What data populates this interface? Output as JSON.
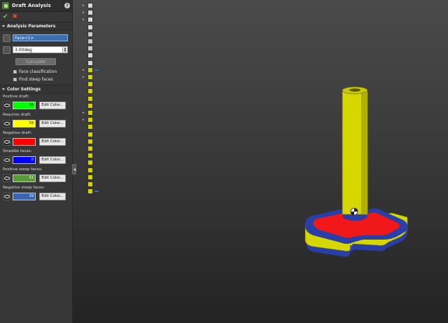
{
  "panel": {
    "title": "Draft Analysis",
    "help_glyph": "?",
    "ok_glyph": "✔",
    "cancel_glyph": "✖",
    "analysis_params": {
      "header": "Analysis Parameters",
      "face_value": "Face<1>",
      "angle_value": "3.00deg",
      "calculate_label": "Calculate",
      "face_classification_label": "Face classification",
      "find_steep_label": "Find steep faces",
      "check_glyph": "✓"
    },
    "color_settings": {
      "header": "Color Settings",
      "edit_label": "Edit Color...",
      "rows": [
        {
          "label": "Positive draft:",
          "count": "35",
          "color": "#00ff00"
        },
        {
          "label": "Requires draft:",
          "count": "59",
          "color": "#ffff00"
        },
        {
          "label": "Negative draft:",
          "count": "",
          "color": "#ff0000"
        },
        {
          "label": "Straddle faces:",
          "count": "0",
          "color": "#0000ff"
        },
        {
          "label": "Positive steep faces:",
          "count": "51",
          "color": "#5a9a3a"
        },
        {
          "label": "Negative steep faces:",
          "count": "29",
          "color": "#3a66b0"
        }
      ]
    }
  },
  "tree": {
    "items": [
      {
        "label": "",
        "icon": "folder-icon",
        "color": "#d8d8d8",
        "arrow": "▸"
      },
      {
        "label": "",
        "icon": "sensor-icon",
        "color": "#d8d8d8",
        "arrow": "▸"
      },
      {
        "label": "",
        "icon": "annotation-icon",
        "color": "#d8d8d8",
        "arrow": "▸"
      },
      {
        "label": "",
        "icon": "material-icon",
        "color": "#d8d8d8",
        "arrow": ""
      },
      {
        "label": "",
        "icon": "plane-icon",
        "color": "#c8c8c8",
        "arrow": ""
      },
      {
        "label": "",
        "icon": "plane-icon",
        "color": "#c8c8c8",
        "arrow": ""
      },
      {
        "label": "",
        "icon": "plane-icon",
        "color": "#c8c8c8",
        "arrow": ""
      },
      {
        "label": "",
        "icon": "origin-icon",
        "color": "#d8d8d8",
        "arrow": ""
      },
      {
        "label": "",
        "icon": "origin-icon",
        "color": "#d8d8d8",
        "arrow": ""
      },
      {
        "label": "",
        "icon": "extrude-icon",
        "color": "#d4d400",
        "arrow": "▸",
        "selected": true
      },
      {
        "label": "",
        "icon": "extrude-icon",
        "color": "#d4d400",
        "arrow": "▸"
      },
      {
        "label": "",
        "icon": "fillet-icon",
        "color": "#d4d400",
        "arrow": ""
      },
      {
        "label": "",
        "icon": "fillet-icon",
        "color": "#d4d400",
        "arrow": ""
      },
      {
        "label": "",
        "icon": "fillet-icon",
        "color": "#d4d400",
        "arrow": ""
      },
      {
        "label": "",
        "icon": "fillet-icon",
        "color": "#d4d400",
        "arrow": ""
      },
      {
        "label": "",
        "icon": "extrude-icon",
        "color": "#d4d400",
        "arrow": "▸"
      },
      {
        "label": "",
        "icon": "extrude-icon",
        "color": "#d4d400",
        "arrow": "▸"
      },
      {
        "label": "",
        "icon": "fillet-icon",
        "color": "#d4d400",
        "arrow": ""
      },
      {
        "label": "",
        "icon": "fillet-icon",
        "color": "#d4d400",
        "arrow": ""
      },
      {
        "label": "",
        "icon": "fillet-icon",
        "color": "#d4d400",
        "arrow": ""
      },
      {
        "label": "",
        "icon": "fillet-icon",
        "color": "#d4d400",
        "arrow": ""
      },
      {
        "label": "",
        "icon": "fillet-icon",
        "color": "#d4d400",
        "arrow": ""
      },
      {
        "label": "",
        "icon": "fillet-icon",
        "color": "#d4d400",
        "arrow": ""
      },
      {
        "label": "",
        "icon": "fillet-icon",
        "color": "#d4d400",
        "arrow": ""
      },
      {
        "label": "",
        "icon": "fillet-icon",
        "color": "#d4d400",
        "arrow": ""
      },
      {
        "label": "",
        "icon": "fillet-icon",
        "color": "#d4d400",
        "arrow": ""
      },
      {
        "label": "",
        "icon": "shell-icon",
        "color": "#d4d400",
        "arrow": "",
        "selected": true
      }
    ]
  },
  "model": {
    "colors": {
      "yellow": "#d6d600",
      "yellow_dark": "#9c9c00",
      "red": "#f01818",
      "blue": "#2a3ea8",
      "blue_dark": "#1c2a78"
    }
  }
}
